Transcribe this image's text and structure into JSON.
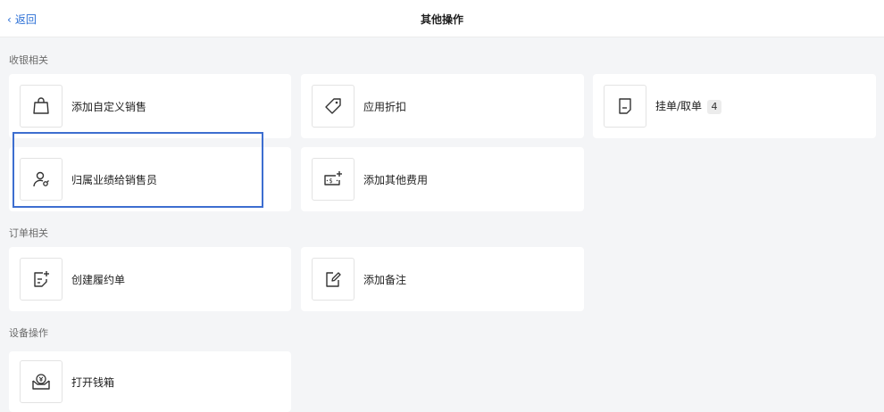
{
  "header": {
    "back_label": "返回",
    "title": "其他操作"
  },
  "sections": [
    {
      "label": "收银相关",
      "items": [
        {
          "label": "添加自定义销售",
          "icon": "shopping-bag-icon"
        },
        {
          "label": "应用折扣",
          "icon": "tag-icon"
        },
        {
          "label": "挂单/取单",
          "icon": "document-icon",
          "badge": "4"
        },
        {
          "label": "归属业绩给销售员",
          "icon": "user-assign-icon"
        },
        {
          "label": "添加其他费用",
          "icon": "add-fee-icon"
        }
      ]
    },
    {
      "label": "订单相关",
      "items": [
        {
          "label": "创建履约单",
          "icon": "add-document-icon"
        },
        {
          "label": "添加备注",
          "icon": "edit-note-icon"
        }
      ]
    },
    {
      "label": "设备操作",
      "items": [
        {
          "label": "打开钱箱",
          "icon": "cash-box-icon"
        }
      ]
    }
  ],
  "colors": {
    "accent": "#2b6fd6",
    "selection": "#3d6ed0",
    "background": "#f4f5f7",
    "card": "#ffffff"
  }
}
